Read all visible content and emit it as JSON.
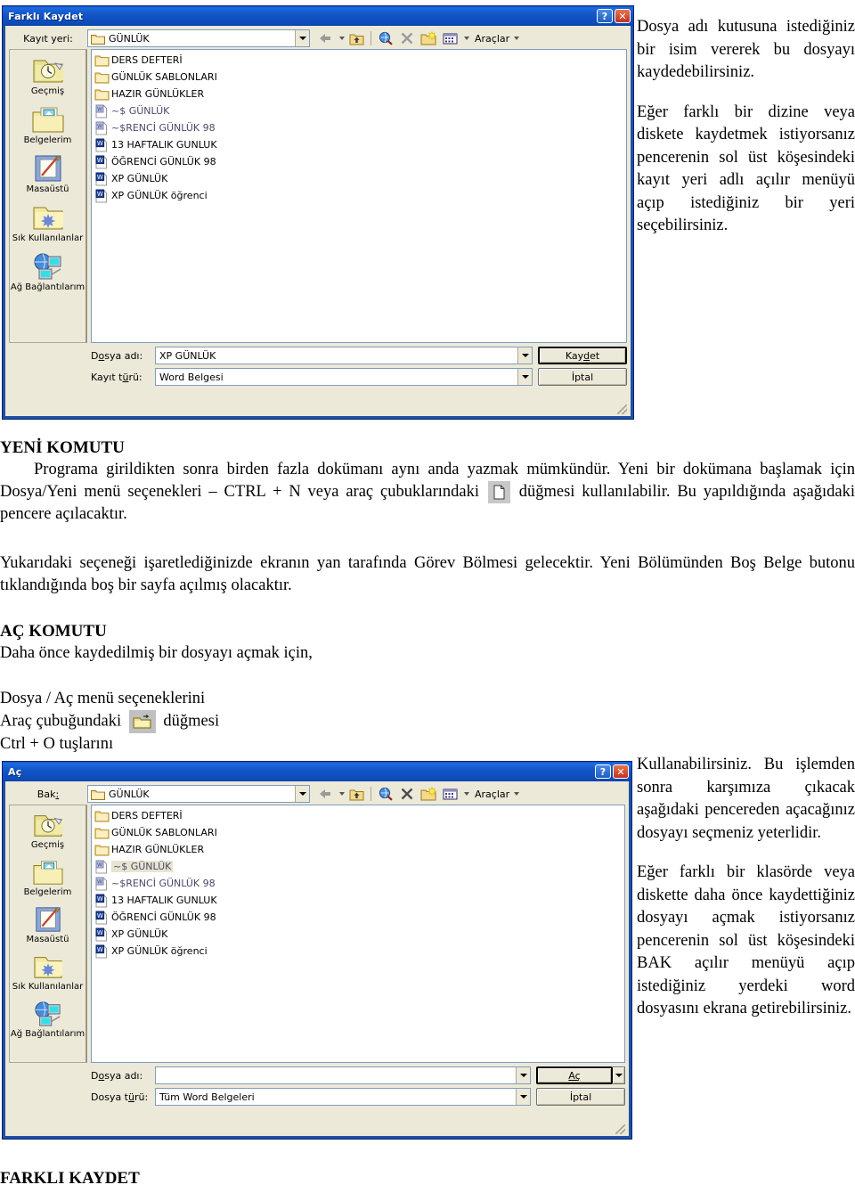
{
  "dialog_save": {
    "title": "Farklı Kaydet",
    "help_button": "?",
    "close_button": "✕",
    "save_in_label": "Kayıt yeri:",
    "location_value": "GÜNLÜK",
    "toolbar": {
      "back_icon": "back-arrow-icon",
      "up_icon": "up-one-level-icon",
      "search_icon": "search-web-icon",
      "delete_icon": "delete-icon",
      "newfolder_icon": "new-folder-icon",
      "views_icon": "views-icon",
      "tools_label": "Araçlar"
    },
    "places": [
      {
        "label": "Geçmiş",
        "icon": "history-folder-icon"
      },
      {
        "label": "Belgelerim",
        "icon": "my-documents-icon"
      },
      {
        "label": "Masaüstü",
        "icon": "desktop-icon"
      },
      {
        "label": "Sık Kullanılanlar",
        "icon": "favorites-folder-icon"
      },
      {
        "label": "Ağ Bağlantılarım",
        "icon": "network-places-icon"
      }
    ],
    "files": [
      {
        "name": "DERS DEFTERİ",
        "type": "folder",
        "selected": false,
        "dim": false
      },
      {
        "name": "GÜNLÜK SABLONLARI",
        "type": "folder",
        "selected": false,
        "dim": false
      },
      {
        "name": "HAZIR GÜNLÜKLER",
        "type": "folder",
        "selected": false,
        "dim": false
      },
      {
        "name": "~$ GÜNLÜK",
        "type": "word-temp",
        "selected": false,
        "dim": true
      },
      {
        "name": "~$RENCİ GÜNLÜK 98",
        "type": "word-temp",
        "selected": false,
        "dim": true
      },
      {
        "name": "13 HAFTALIK GUNLUK",
        "type": "word",
        "selected": false,
        "dim": false
      },
      {
        "name": "ÖĞRENCİ GÜNLÜK 98",
        "type": "word",
        "selected": false,
        "dim": false
      },
      {
        "name": "XP GÜNLÜK",
        "type": "word",
        "selected": false,
        "dim": false
      },
      {
        "name": "XP GÜNLÜK öğrenci",
        "type": "word",
        "selected": false,
        "dim": false
      }
    ],
    "filename_label": "Dosya adı:",
    "filename_value": "XP GÜNLÜK",
    "filetype_label": "Kayıt türü:",
    "filetype_value": "Word Belgesi",
    "ok_button": "Kaydet",
    "cancel_button": "İptal"
  },
  "dialog_open": {
    "title": "Aç",
    "help_button": "?",
    "close_button": "✕",
    "look_in_label": "Bak:",
    "location_value": "GÜNLÜK",
    "toolbar": {
      "back_icon": "back-arrow-icon",
      "up_icon": "up-one-level-icon",
      "search_icon": "search-web-icon",
      "delete_icon": "delete-icon",
      "newfolder_icon": "new-folder-icon",
      "views_icon": "views-icon",
      "tools_label": "Araçlar"
    },
    "places": [
      {
        "label": "Geçmiş",
        "icon": "history-folder-icon"
      },
      {
        "label": "Belgelerim",
        "icon": "my-documents-icon"
      },
      {
        "label": "Masaüstü",
        "icon": "desktop-icon"
      },
      {
        "label": "Sık Kullanılanlar",
        "icon": "favorites-folder-icon"
      },
      {
        "label": "Ağ Bağlantılarım",
        "icon": "network-places-icon"
      }
    ],
    "files": [
      {
        "name": "DERS DEFTERİ",
        "type": "folder",
        "selected": false,
        "dim": false
      },
      {
        "name": "GÜNLÜK SABLONLARI",
        "type": "folder",
        "selected": false,
        "dim": false
      },
      {
        "name": "HAZIR GÜNLÜKLER",
        "type": "folder",
        "selected": false,
        "dim": false
      },
      {
        "name": "~$ GÜNLÜK",
        "type": "word-temp",
        "selected": true,
        "dim": true
      },
      {
        "name": "~$RENCİ GÜNLÜK 98",
        "type": "word-temp",
        "selected": false,
        "dim": true
      },
      {
        "name": "13 HAFTALIK GUNLUK",
        "type": "word",
        "selected": false,
        "dim": false
      },
      {
        "name": "ÖĞRENCİ GÜNLÜK 98",
        "type": "word",
        "selected": false,
        "dim": false
      },
      {
        "name": "XP GÜNLÜK",
        "type": "word",
        "selected": false,
        "dim": false
      },
      {
        "name": "XP GÜNLÜK öğrenci",
        "type": "word",
        "selected": false,
        "dim": false
      }
    ],
    "filename_label": "Dosya adı:",
    "filename_value": "",
    "filename_placeholder": "",
    "filetype_label": "Dosya türü:",
    "filetype_value": "Tüm Word Belgeleri",
    "ok_button": "Aç",
    "cancel_button": "İptal"
  },
  "text": {
    "right_top_p1": "Dosya adı kutusuna istediğiniz bir isim vererek bu dosyayı kaydedebilirsiniz.",
    "right_top_p2": "Eğer farklı bir dizine veya diskete kaydetmek istiyorsanız pencerenin sol üst köşesindeki kayıt yeri adlı açılır menüyü açıp istediğiniz bir yeri seçebilirsiniz.",
    "new_heading": "YENİ KOMUTU",
    "new_para_a": "Programa girildikten sonra birden fazla dokümanı aynı anda yazmak mümkündür. Yeni bir dokümana başlamak için Dosya/Yeni menü seçenekleri – CTRL + N veya araç çubuklarındaki",
    "new_para_b": "düğmesi kullanılabilir. Bu yapıldığında aşağıdaki pencere açılacaktır.",
    "taskpane_para": "Yukarıdaki seçeneği işaretlediğinizde ekranın yan tarafında Görev Bölmesi gelecektir. Yeni Bölümünden Boş Belge butonu tıklandığında boş bir sayfa açılmış olacaktır.",
    "open_heading": "AÇ KOMUTU",
    "open_intro": "Daha önce kaydedilmiş bir dosyayı açmak için,",
    "open_line1": "Dosya / Aç menü seçeneklerini",
    "open_line2_a": "Araç çubuğundaki",
    "open_line2_b": "düğmesi",
    "open_line3": "Ctrl + O tuşlarını",
    "right_mid_p1": "Kullanabilirsiniz. Bu işlemden sonra karşımıza çıkacak aşağıdaki pencereden açacağınız dosyayı seçmeniz yeterlidir.",
    "right_mid_p2": "Eğer farklı bir klasörde veya diskette daha önce kaydettiğiniz dosyayı açmak istiyorsanız pencerenin sol üst köşesindeki BAK açılır menüyü açıp istediğiniz yerdeki word dosyasını ekrana getirebilirsiniz.",
    "footer_heading": "FARKLI KAYDET"
  },
  "colors": {
    "titlebar_blue": "#1456c8",
    "dialog_face": "#ece9d8",
    "combo_border": "#7f9db9",
    "selection": "#e8e4d0",
    "word_icon_blue": "#1c3f94",
    "folder_yellow": "#f5d98c"
  }
}
